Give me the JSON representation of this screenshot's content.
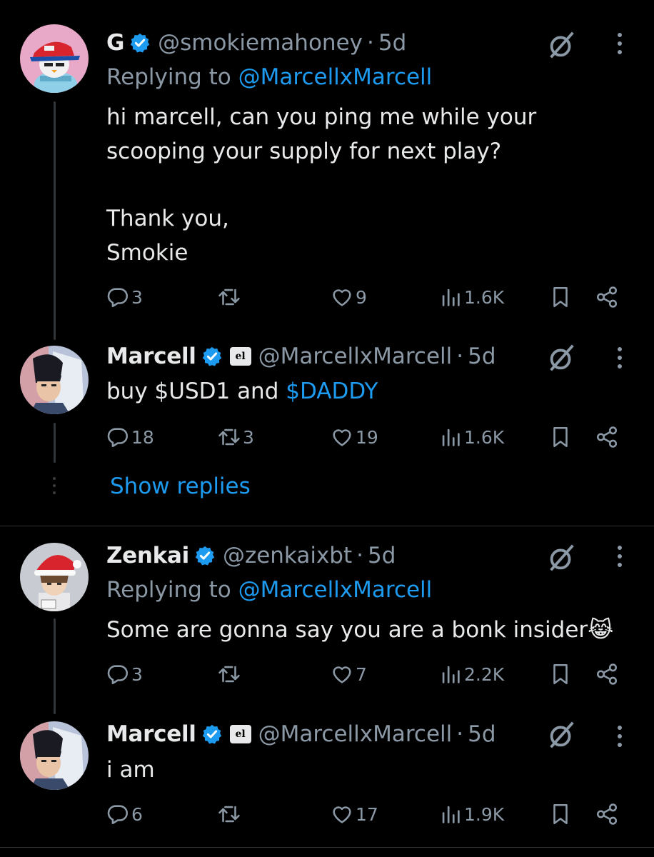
{
  "tweets": [
    {
      "name": "G",
      "handle": "@smokiemahoney",
      "dot": "·",
      "time": "5d",
      "replying_prefix": "Replying to",
      "replying_handle": "@MarcellxMarcell",
      "lines": [
        "hi marcell, can you ping me while your",
        "scooping your supply for next play?",
        "Thank you,",
        "Smokie"
      ],
      "replies": "3",
      "retweets": "",
      "likes": "9",
      "views": "1.6K",
      "verified": true,
      "affiliate": false
    },
    {
      "name": "Marcell",
      "handle": "@MarcellxMarcell",
      "dot": "·",
      "time": "5d",
      "affiliate_label": "el",
      "text_prefix": "buy $USD1 and ",
      "text_link": "$DADDY",
      "replies": "18",
      "retweets": "3",
      "likes": "19",
      "views": "1.6K",
      "verified": true,
      "affiliate": true
    },
    {
      "name": "Zenkai",
      "handle": "@zenkaixbt",
      "dot": "·",
      "time": "5d",
      "replying_prefix": "Replying to",
      "replying_handle": "@MarcellxMarcell",
      "text": "Some are gonna say you are a bonk insider😹",
      "replies": "3",
      "retweets": "",
      "likes": "7",
      "views": "2.2K",
      "verified": true,
      "affiliate": false
    },
    {
      "name": "Marcell",
      "handle": "@MarcellxMarcell",
      "dot": "·",
      "time": "5d",
      "affiliate_label": "el",
      "text": "i am",
      "replies": "6",
      "retweets": "",
      "likes": "17",
      "views": "1.9K",
      "verified": true,
      "affiliate": true
    }
  ],
  "show_replies_label": "Show replies",
  "colors": {
    "background": "#000000",
    "text": "#e7e9ea",
    "muted": "#8b98a5",
    "link": "#1d9bf0",
    "verified": "#1d9bf0"
  },
  "icons": [
    "reply-icon",
    "retweet-icon",
    "like-icon",
    "views-icon",
    "bookmark-icon",
    "share-icon",
    "grok-icon",
    "more-icon",
    "verified-icon"
  ]
}
